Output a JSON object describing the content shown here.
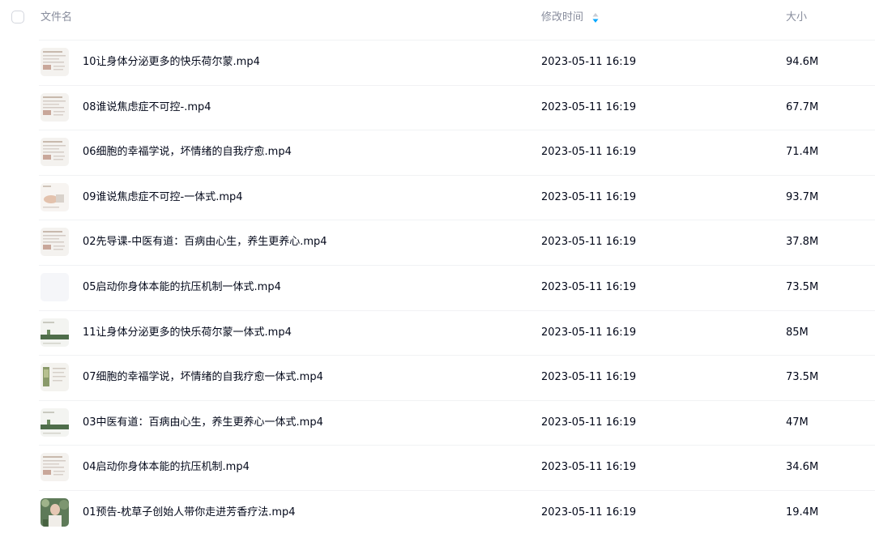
{
  "header": {
    "name_label": "文件名",
    "time_label": "修改时间",
    "size_label": "大小"
  },
  "colors": {
    "sort_active": "#06a7ff",
    "header_text": "#878c9c",
    "row_text": "#03081a"
  },
  "files": [
    {
      "name": "10让身体分泌更多的快乐荷尔蒙.mp4",
      "modified": "2023-05-11 16:19",
      "size": "94.6M",
      "thumb": "doc"
    },
    {
      "name": "08谁说焦虑症不可控-.mp4",
      "modified": "2023-05-11 16:19",
      "size": "67.7M",
      "thumb": "doc"
    },
    {
      "name": "06细胞的幸福学说，坏情绪的自我疗愈.mp4",
      "modified": "2023-05-11 16:19",
      "size": "71.4M",
      "thumb": "doc"
    },
    {
      "name": "09谁说焦虑症不可控-一体式.mp4",
      "modified": "2023-05-11 16:19",
      "size": "93.7M",
      "thumb": "hand"
    },
    {
      "name": "02先导课-中医有道：百病由心生，养生更养心.mp4",
      "modified": "2023-05-11 16:19",
      "size": "37.8M",
      "thumb": "doc"
    },
    {
      "name": "05启动你身体本能的抗压机制一体式.mp4",
      "modified": "2023-05-11 16:19",
      "size": "73.5M",
      "thumb": "blank"
    },
    {
      "name": "11让身体分泌更多的快乐荷尔蒙一体式.mp4",
      "modified": "2023-05-11 16:19",
      "size": "85M",
      "thumb": "green"
    },
    {
      "name": "07细胞的幸福学说，坏情绪的自我疗愈一体式.mp4",
      "modified": "2023-05-11 16:19",
      "size": "73.5M",
      "thumb": "plant"
    },
    {
      "name": "03中医有道：百病由心生，养生更养心一体式.mp4",
      "modified": "2023-05-11 16:19",
      "size": "47M",
      "thumb": "green"
    },
    {
      "name": "04启动你身体本能的抗压机制.mp4",
      "modified": "2023-05-11 16:19",
      "size": "34.6M",
      "thumb": "doc"
    },
    {
      "name": "01预告-枕草子创始人带你走进芳香疗法.mp4",
      "modified": "2023-05-11 16:19",
      "size": "19.4M",
      "thumb": "photo"
    }
  ]
}
